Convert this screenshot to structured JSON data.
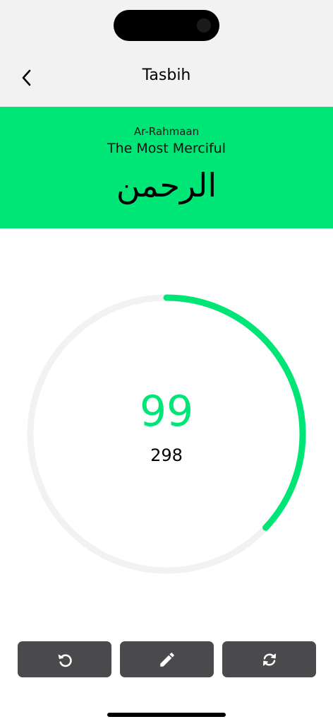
{
  "header": {
    "title": "Tasbih",
    "back_icon": "chevron-left-icon"
  },
  "dhikr": {
    "transliteration": "Ar-Rahmaan",
    "meaning": "The Most Merciful",
    "arabic": "الرحمن"
  },
  "counter": {
    "count": "99",
    "total": "298",
    "progress": 0.37
  },
  "actions": [
    {
      "name": "reset",
      "icon": "undo-icon"
    },
    {
      "name": "edit",
      "icon": "pencil-icon"
    },
    {
      "name": "sync",
      "icon": "sync-icon"
    }
  ],
  "colors": {
    "accent": "#00e676",
    "track": "#f2f2f2",
    "button": "#4a4a4d",
    "header_bg": "#f2f2f2"
  }
}
